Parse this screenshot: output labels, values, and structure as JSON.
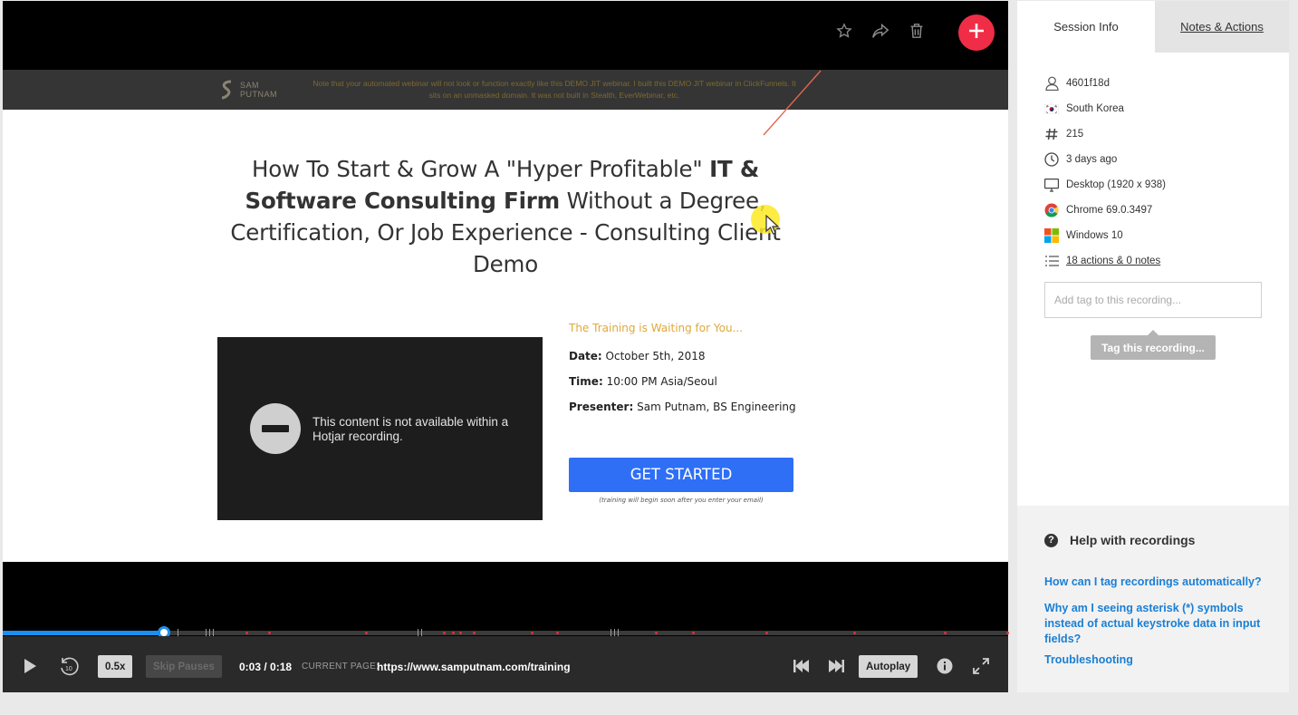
{
  "player": {
    "top_icons": [
      "star-icon",
      "share-icon",
      "trash-icon"
    ],
    "add_icon": "plus-icon",
    "accent_color": "#f02d46"
  },
  "recorded_page": {
    "logo_text": "SAM PUTNAM",
    "banner_note": "Note that your automated webinar will not look or function exactly like this DEMO JIT webinar. I built this DEMO JIT webinar in ClickFunnels. It sits on an unmasked domain. It was not built in Stealth, EverWebinar, etc.",
    "headline_part1": "How To Start & Grow A \"Hyper Profitable\" ",
    "headline_bold": "IT & Software Consulting Firm",
    "headline_part2": " Without a Degree, Certification, Or Job Experience - Consulting Client Demo",
    "blocked_message": "This content is not available within a Hotjar recording.",
    "training_title": "The Training is Waiting for You...",
    "date_label": "Date:",
    "date_value": " October 5th, 2018",
    "time_label": "Time:",
    "time_value": " 10:00 PM Asia/Seoul",
    "presenter_label": "Presenter:",
    "presenter_value": " Sam Putnam, BS Engineering",
    "cta_label": "GET STARTED",
    "cta_note": "(training will begin soon after you enter your email)"
  },
  "controls": {
    "progress": 0.16,
    "speed_label": "0.5x",
    "skip_pauses_label": "Skip Pauses",
    "time_display": "0:03 / 0:18",
    "current_page_label": "CURRENT PAGE:",
    "current_page_url": "https://www.samputnam.com/training",
    "autoplay_label": "Autoplay",
    "icons": [
      "play-icon",
      "rewind-10-icon",
      "skip-previous-icon",
      "skip-next-icon",
      "info-icon",
      "fullscreen-icon"
    ]
  },
  "side_panel": {
    "tabs": [
      {
        "label": "Session Info"
      },
      {
        "label": "Notes & Actions"
      }
    ],
    "info": {
      "user_id": "4601f18d",
      "country": "South Korea",
      "number": "215",
      "time_ago": "3 days ago",
      "device": "Desktop (1920 x 938)",
      "browser": "Chrome 69.0.3497",
      "os": "Windows 10",
      "actions": "18 actions & 0 notes"
    },
    "tag_placeholder": "Add tag to this recording...",
    "tag_button": "Tag this recording...",
    "help": {
      "title": "Help with recordings",
      "links": [
        "How can I tag recordings automatically?",
        "Why am I seeing asterisk (*) symbols instead of actual keystroke data in input fields?",
        "Troubleshooting"
      ]
    }
  }
}
